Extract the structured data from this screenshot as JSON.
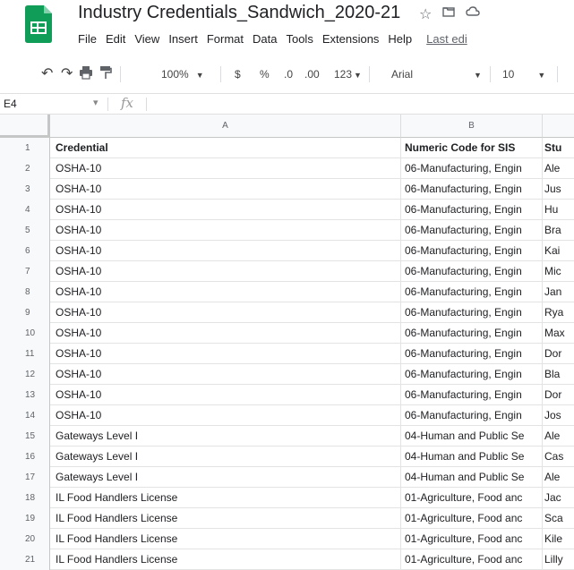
{
  "doc": {
    "title": "Industry Credentials_Sandwich_2020-21",
    "menu": [
      "File",
      "Edit",
      "View",
      "Insert",
      "Format",
      "Data",
      "Tools",
      "Extensions",
      "Help"
    ],
    "last_edit": "Last edi"
  },
  "toolbar": {
    "zoom": "100%",
    "currency": "$",
    "percent": "%",
    "dec_less": ".0",
    "dec_more": ".00",
    "number_format": "123",
    "font": "Arial",
    "font_size": "10"
  },
  "formula_bar": {
    "cell_ref": "E4",
    "fx_label": "fx"
  },
  "columns": [
    "A",
    "B"
  ],
  "rows": [
    {
      "num": "1",
      "a": "Credential",
      "b": "Numeric Code for SIS",
      "c": "Stu"
    },
    {
      "num": "2",
      "a": "OSHA-10",
      "b": "06-Manufacturing, Engin",
      "c": "Ale"
    },
    {
      "num": "3",
      "a": "OSHA-10",
      "b": "06-Manufacturing, Engin",
      "c": "Jus"
    },
    {
      "num": "4",
      "a": "OSHA-10",
      "b": "06-Manufacturing, Engin",
      "c": "Hu"
    },
    {
      "num": "5",
      "a": "OSHA-10",
      "b": "06-Manufacturing, Engin",
      "c": "Bra"
    },
    {
      "num": "6",
      "a": "OSHA-10",
      "b": "06-Manufacturing, Engin",
      "c": "Kai"
    },
    {
      "num": "7",
      "a": "OSHA-10",
      "b": "06-Manufacturing, Engin",
      "c": "Mic"
    },
    {
      "num": "8",
      "a": "OSHA-10",
      "b": "06-Manufacturing, Engin",
      "c": "Jan"
    },
    {
      "num": "9",
      "a": "OSHA-10",
      "b": "06-Manufacturing, Engin",
      "c": "Rya"
    },
    {
      "num": "10",
      "a": "OSHA-10",
      "b": "06-Manufacturing, Engin",
      "c": "Max"
    },
    {
      "num": "11",
      "a": "OSHA-10",
      "b": "06-Manufacturing, Engin",
      "c": "Dor"
    },
    {
      "num": "12",
      "a": "OSHA-10",
      "b": "06-Manufacturing, Engin",
      "c": "Bla"
    },
    {
      "num": "13",
      "a": "OSHA-10",
      "b": "06-Manufacturing, Engin",
      "c": "Dor"
    },
    {
      "num": "14",
      "a": "OSHA-10",
      "b": "06-Manufacturing, Engin",
      "c": "Jos"
    },
    {
      "num": "15",
      "a": "Gateways Level I",
      "b": "04-Human and Public Se",
      "c": "Ale"
    },
    {
      "num": "16",
      "a": "Gateways Level I",
      "b": "04-Human and Public Se",
      "c": "Cas"
    },
    {
      "num": "17",
      "a": "Gateways Level I",
      "b": "04-Human and Public Se",
      "c": "Ale"
    },
    {
      "num": "18",
      "a": "IL Food Handlers License",
      "b": "01-Agriculture, Food anc",
      "c": "Jac"
    },
    {
      "num": "19",
      "a": "IL Food Handlers License",
      "b": "01-Agriculture, Food anc",
      "c": "Sca"
    },
    {
      "num": "20",
      "a": "IL Food Handlers License",
      "b": "01-Agriculture, Food anc",
      "c": "Kile"
    },
    {
      "num": "21",
      "a": "IL Food Handlers License",
      "b": "01-Agriculture, Food anc",
      "c": "Lilly"
    }
  ],
  "colors": {
    "sheets_green": "#0f9d58",
    "header_bg": "#f8f9fa",
    "grid_line": "#e2e3e3"
  }
}
